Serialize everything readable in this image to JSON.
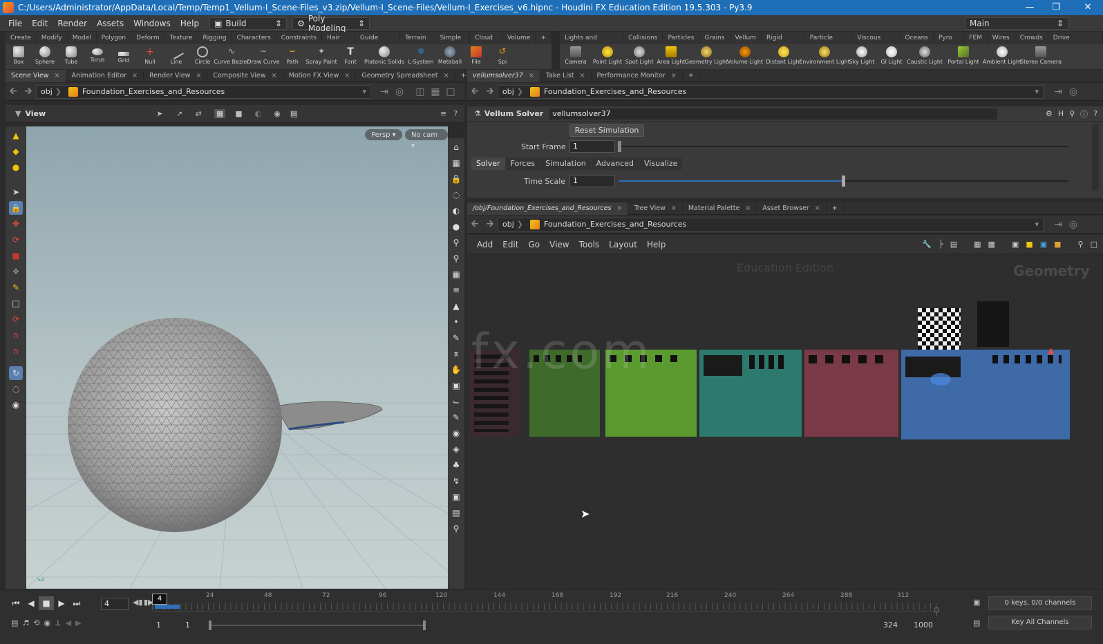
{
  "window": {
    "title": "C:/Users/Administrator/AppData/Local/Temp/Temp1_Vellum-I_Scene-Files_v3.zip/Vellum-I_Scene-Files/Vellum-I_Exercises_v6.hipnc - Houdini FX Education Edition 19.5.303 - Py3.9",
    "minimize": "—",
    "maximize": "❐",
    "close": "✕"
  },
  "menubar": {
    "items": [
      "File",
      "Edit",
      "Render",
      "Assets",
      "Windows",
      "Help"
    ],
    "build_label": "Build",
    "desktop_label": "Poly Modeling",
    "main_label": "Main"
  },
  "shelf_left": {
    "tabs": [
      "Create",
      "Modify",
      "Model",
      "Polygon",
      "Deform",
      "Texture",
      "Rigging",
      "Characters",
      "Constraints",
      "Hair Utils",
      "Guide Process",
      "Terrain FX",
      "Simple FX",
      "Cloud FX",
      "Volume"
    ],
    "tools": [
      "Box",
      "Sphere",
      "Tube",
      "Torus",
      "Grid",
      "Null",
      "Line",
      "Circle",
      "Curve Bezier",
      "Draw Curve",
      "Path",
      "Spray Paint",
      "Font",
      "Platonic Solids",
      "L-System",
      "Metaball",
      "File",
      "Spi"
    ]
  },
  "shelf_right": {
    "tabs": [
      "Lights and Cameras",
      "Collisions",
      "Particles",
      "Grains",
      "Vellum",
      "Rigid Bodies",
      "Particle Fluids",
      "Viscous Fluids",
      "Oceans",
      "Pyro FX",
      "FEM",
      "Wires",
      "Crowds",
      "Drive Simulation"
    ],
    "tools": [
      "Camera",
      "Point Light",
      "Spot Light",
      "Area Light",
      "Geometry Light",
      "Volume Light",
      "Distant Light",
      "Environment Light",
      "Sky Light",
      "GI Light",
      "Caustic Light",
      "Portal Light",
      "Ambient Light",
      "Stereo Camera"
    ]
  },
  "left_pane": {
    "tabs": [
      "Scene View",
      "Animation Editor",
      "Render View",
      "Composite View",
      "Motion FX View",
      "Geometry Spreadsheet"
    ],
    "path_root": "obj",
    "path_node": "Foundation_Exercises_and_Resources",
    "view_label": "View",
    "persp_label": "Persp ▾",
    "cam_label": "No cam ▾"
  },
  "right_top_pane": {
    "tabs": [
      "vellumsolver37",
      "Take List",
      "Performance Monitor"
    ],
    "path_root": "obj",
    "path_node": "Foundation_Exercises_and_Resources",
    "node_type": "Vellum Solver",
    "node_name": "vellumsolver37",
    "reset_button": "Reset Simulation",
    "start_frame_label": "Start Frame",
    "start_frame_value": "1",
    "subtabs": [
      "Solver",
      "Forces",
      "Simulation",
      "Advanced",
      "Visualize"
    ],
    "time_scale_label": "Time Scale",
    "time_scale_value": "1"
  },
  "network_pane": {
    "tabs": [
      "/obj/Foundation_Exercises_and_Resources",
      "Tree View",
      "Material Palette",
      "Asset Browser"
    ],
    "path_root": "obj",
    "path_node": "Foundation_Exercises_and_Resources",
    "menu": [
      "Add",
      "Edit",
      "Go",
      "View",
      "Tools",
      "Layout",
      "Help"
    ],
    "edition_watermark": "Education Edition",
    "context_label": "Geometry",
    "watermark": "iiivfx.com",
    "box_colors": [
      "#3a2a30",
      "#3f6b2a",
      "#5a9a2e",
      "#2c7a6e",
      "#7a3a48",
      "#3e6aa8"
    ]
  },
  "timeline": {
    "current_frame": "4",
    "frame_marker": "4",
    "ticks": [
      "24",
      "48",
      "72",
      "96",
      "120",
      "144",
      "168",
      "192",
      "216",
      "240",
      "264",
      "288",
      "312"
    ],
    "range_start": "1",
    "range_start2": "1",
    "range_end": "324",
    "range_end2": "1000",
    "keys_label": "0 keys, 0/0 channels",
    "key_all_label": "Key All Channels"
  }
}
